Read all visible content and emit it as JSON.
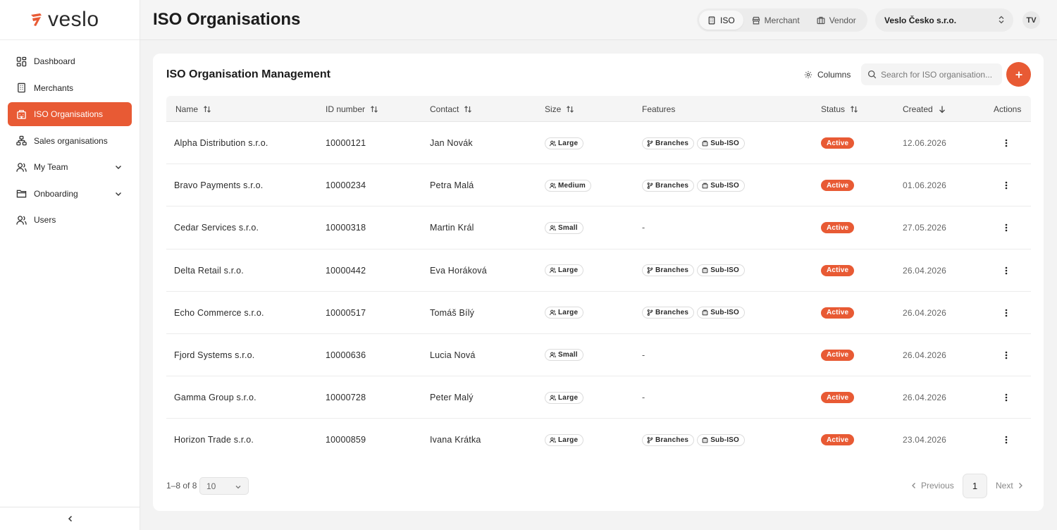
{
  "brand": {
    "name": "veslo",
    "accent": "#e85a34"
  },
  "sidebar": {
    "items": [
      {
        "label": "Dashboard",
        "icon": "dashboard-icon",
        "active": false
      },
      {
        "label": "Merchants",
        "icon": "building-icon",
        "active": false
      },
      {
        "label": "ISO Organisations",
        "icon": "organisations-icon",
        "active": true
      },
      {
        "label": "Sales organisations",
        "icon": "hierarchy-icon",
        "active": false
      },
      {
        "label": "My Team",
        "icon": "team-icon",
        "active": false,
        "expandable": true
      },
      {
        "label": "Onboarding",
        "icon": "folder-icon",
        "active": false,
        "expandable": true
      },
      {
        "label": "Users",
        "icon": "users-icon",
        "active": false
      }
    ]
  },
  "header": {
    "title": "ISO Organisations",
    "segments": [
      {
        "label": "ISO",
        "icon": "building-icon",
        "active": true
      },
      {
        "label": "Merchant",
        "icon": "store-icon",
        "active": false
      },
      {
        "label": "Vendor",
        "icon": "shop-icon",
        "active": false
      }
    ],
    "org_select": "Veslo Česko s.r.o.",
    "avatar_initials": "TV"
  },
  "card": {
    "title": "ISO Organisation Management",
    "columns_label": "Columns",
    "search_placeholder": "Search for ISO organisation..."
  },
  "table": {
    "headers": {
      "name": "Name",
      "id": "ID number",
      "contact": "Contact",
      "size": "Size",
      "features": "Features",
      "status": "Status",
      "created": "Created",
      "actions": "Actions"
    },
    "rows": [
      {
        "name": "Alpha Distribution s.r.o.",
        "id": "10000121",
        "contact": "Jan Novák",
        "size": "Large",
        "features": [
          "Branches",
          "Sub-ISO"
        ],
        "status": "Active",
        "created": "12.06.2026"
      },
      {
        "name": "Bravo Payments s.r.o.",
        "id": "10000234",
        "contact": "Petra Malá",
        "size": "Medium",
        "features": [
          "Branches",
          "Sub-ISO"
        ],
        "status": "Active",
        "created": "01.06.2026"
      },
      {
        "name": "Cedar Services s.r.o.",
        "id": "10000318",
        "contact": "Martin Král",
        "size": "Small",
        "features": [],
        "status": "Active",
        "created": "27.05.2026"
      },
      {
        "name": "Delta Retail s.r.o.",
        "id": "10000442",
        "contact": "Eva Horáková",
        "size": "Large",
        "features": [
          "Branches",
          "Sub-ISO"
        ],
        "status": "Active",
        "created": "26.04.2026"
      },
      {
        "name": "Echo Commerce s.r.o.",
        "id": "10000517",
        "contact": "Tomáš Bílý",
        "size": "Large",
        "features": [
          "Branches",
          "Sub-ISO"
        ],
        "status": "Active",
        "created": "26.04.2026"
      },
      {
        "name": "Fjord Systems s.r.o.",
        "id": "10000636",
        "contact": "Lucia Nová",
        "size": "Small",
        "features": [],
        "status": "Active",
        "created": "26.04.2026"
      },
      {
        "name": "Gamma Group s.r.o.",
        "id": "10000728",
        "contact": "Peter Malý",
        "size": "Large",
        "features": [],
        "status": "Active",
        "created": "26.04.2026"
      },
      {
        "name": "Horizon Trade s.r.o.",
        "id": "10000859",
        "contact": "Ivana Krátka",
        "size": "Large",
        "features": [
          "Branches",
          "Sub-ISO"
        ],
        "status": "Active",
        "created": "23.04.2026"
      }
    ],
    "empty_features": "-"
  },
  "footer": {
    "range": "1–8 of 8",
    "page_size": "10",
    "previous": "Previous",
    "current_page": "1",
    "next": "Next"
  }
}
